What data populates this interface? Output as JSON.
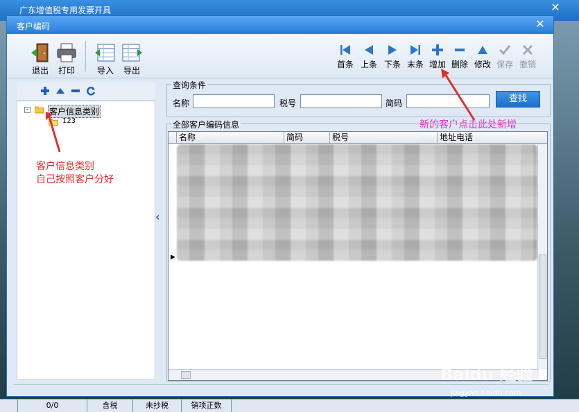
{
  "app": {
    "title": "广东增值税专用发票开具",
    "close": "✕"
  },
  "dialog": {
    "title": "客户编码",
    "close": "✕"
  },
  "toolbar": {
    "exit": "退出",
    "print": "打印",
    "import": "导入",
    "export": "导出",
    "first": "首条",
    "prev": "上条",
    "next": "下条",
    "last": "末条",
    "add": "增加",
    "delete": "删除",
    "edit": "修改",
    "save": "保存",
    "cancel": "撤销"
  },
  "tree": {
    "root": "客户信息类别",
    "child": "123"
  },
  "annotations": {
    "left_line1": "客户信息类别",
    "left_line2": "自己按照客户分好",
    "right": "新的客户点击此处新增"
  },
  "query": {
    "group_title": "查询条件",
    "name_label": "名称",
    "tax_label": "税号",
    "code_label": "简码",
    "name_value": "",
    "tax_value": "",
    "code_value": "",
    "find_button": "查找"
  },
  "grid": {
    "group_title": "全部客户编码信息",
    "columns": [
      "名称",
      "简码",
      "税号",
      "地址电话"
    ]
  },
  "status": {
    "cells": [
      "0/0",
      "含税",
      "未抄税",
      "销项正数"
    ]
  },
  "watermark": {
    "main": "Baidu 经验",
    "sub": "jingyan.baidu.com"
  },
  "colors": {
    "title_bar": "#2a7ed8",
    "find_button": "#1c6fcf",
    "annotation_red": "#e0302c",
    "annotation_pink": "#e52dc5"
  }
}
